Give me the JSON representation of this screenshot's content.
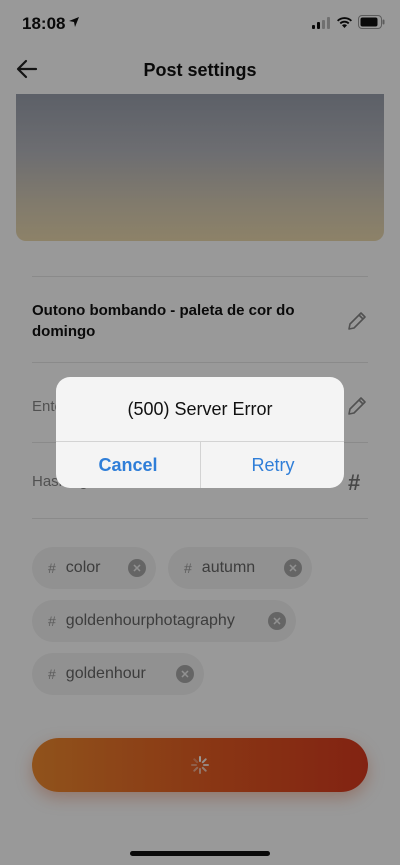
{
  "status_bar": {
    "time": "18:08",
    "icons": [
      "location-arrow-icon",
      "signal-icon",
      "wifi-icon",
      "battery-icon"
    ]
  },
  "header": {
    "back_icon": "back-arrow-icon",
    "title": "Post settings"
  },
  "post": {
    "title": "Outono bombando - paleta de cor do domingo",
    "description_placeholder": "Ente",
    "hashtag_placeholder": "Hashtag",
    "hashtags": [
      {
        "hash": "#",
        "label": "color"
      },
      {
        "hash": "#",
        "label": "autumn"
      },
      {
        "hash": "#",
        "label": "goldenhourphotagraphy"
      },
      {
        "hash": "#",
        "label": "goldenhour"
      }
    ],
    "hash_icon": "#"
  },
  "submit_button": {
    "state": "loading",
    "gradient": [
      "#f08a2e",
      "#d93a1f"
    ]
  },
  "alert": {
    "title": "(500) Server Error",
    "cancel_label": "Cancel",
    "retry_label": "Retry",
    "button_color": "#2f7ed8"
  }
}
